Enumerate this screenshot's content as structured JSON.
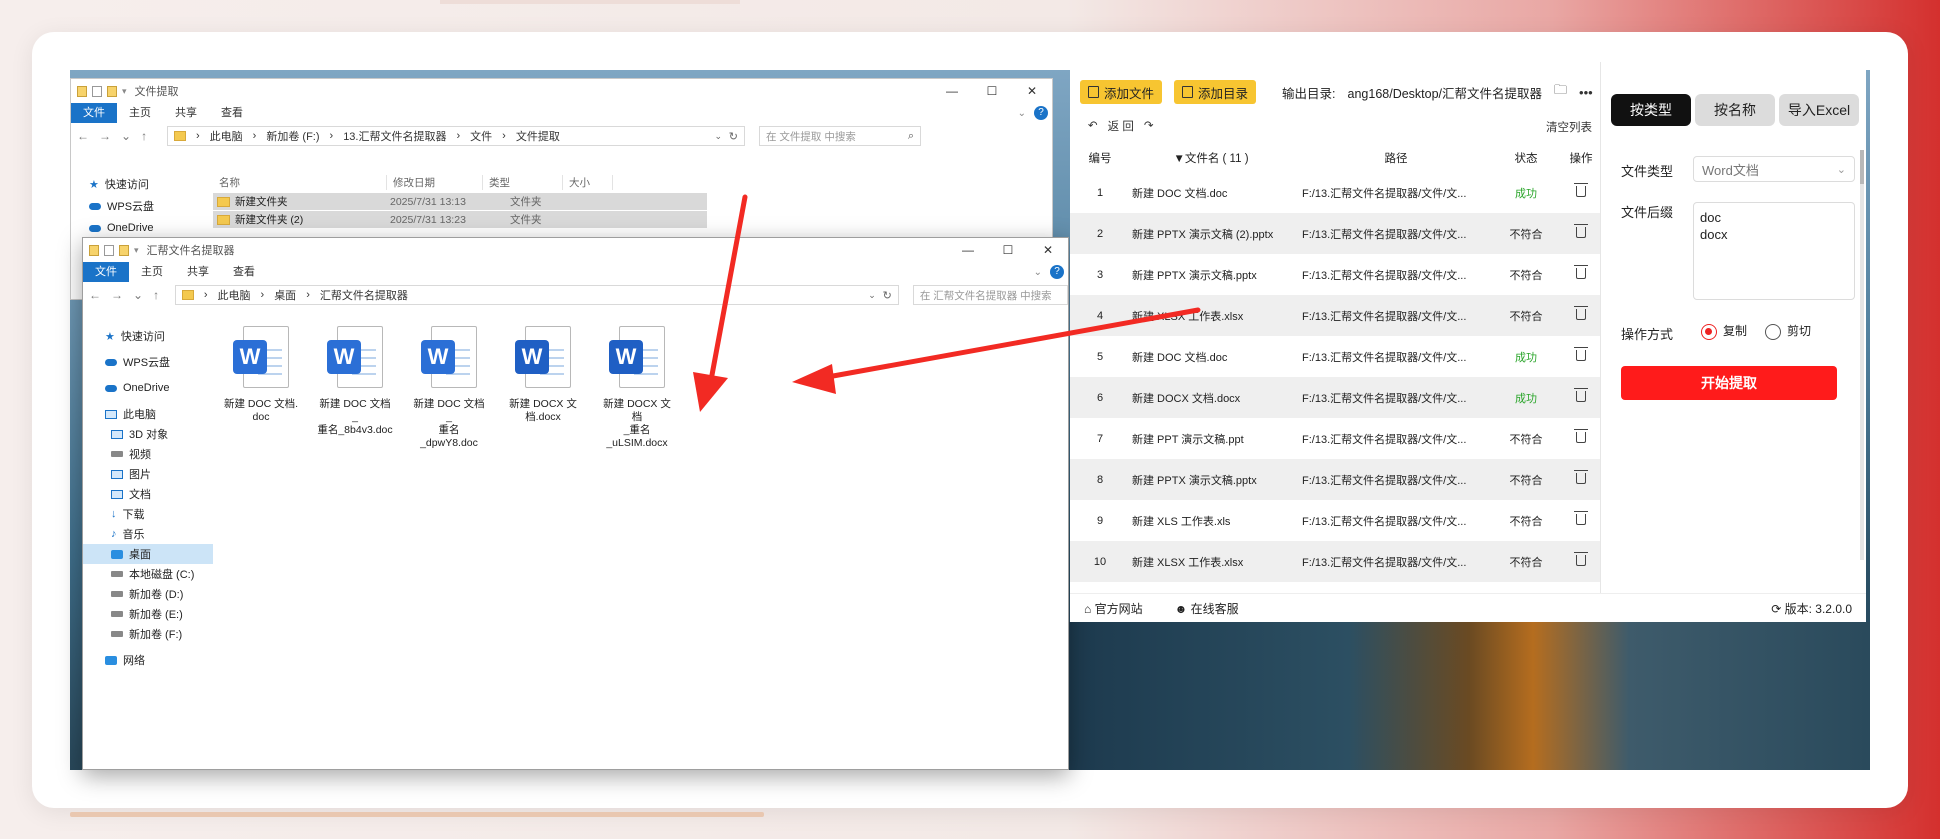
{
  "win1": {
    "title": "文件提取",
    "ribbon": [
      "文件",
      "主页",
      "共享",
      "查看"
    ],
    "address": [
      "此电脑",
      "新加卷 (F:)",
      "13.汇帮文件名提取器",
      "文件",
      "文件提取"
    ],
    "search_placeholder": "在 文件提取 中搜索",
    "nav": [
      "快速访问",
      "WPS云盘",
      "OneDrive"
    ],
    "columns": [
      "名称",
      "修改日期",
      "类型",
      "大小"
    ],
    "rows": [
      {
        "name": "新建文件夹",
        "date": "2025/7/31 13:13",
        "type": "文件夹"
      },
      {
        "name": "新建文件夹 (2)",
        "date": "2025/7/31 13:23",
        "type": "文件夹"
      }
    ]
  },
  "win2": {
    "title": "汇帮文件名提取器",
    "ribbon": [
      "文件",
      "主页",
      "共享",
      "查看"
    ],
    "address": [
      "此电脑",
      "桌面",
      "汇帮文件名提取器"
    ],
    "search_placeholder": "在 汇帮文件名提取器 中搜索",
    "nav": [
      "快速访问",
      "WPS云盘",
      "OneDrive",
      "此电脑",
      "3D 对象",
      "视频",
      "图片",
      "文档",
      "下载",
      "音乐",
      "桌面",
      "本地磁盘 (C:)",
      "新加卷 (D:)",
      "新加卷 (E:)",
      "新加卷 (F:)",
      "网络"
    ],
    "files": [
      {
        "line1": "新建 DOC 文档.",
        "line2": "doc",
        "line3": ""
      },
      {
        "line1": "新建 DOC 文档_",
        "line2": "重名_8b4v3.doc",
        "line3": ""
      },
      {
        "line1": "新建 DOC 文档_",
        "line2": "重名",
        "line3": "_dpwY8.doc"
      },
      {
        "line1": "新建 DOCX 文",
        "line2": "档.docx",
        "line3": ""
      },
      {
        "line1": "新建 DOCX 文档",
        "line2": "_重名",
        "line3": "_uLSIM.docx"
      }
    ],
    "icon_letter": "W"
  },
  "app": {
    "add_file": "添加文件",
    "add_dir": "添加目录",
    "output_label": "输出目录:",
    "output_value": "ang168/Desktop/汇帮文件名提取器",
    "back": "返 回",
    "clear_list": "清空列表",
    "headers": {
      "no": "编号",
      "name": "▼文件名 ( 11 )",
      "path": "路径",
      "status": "状态",
      "op": "操作"
    },
    "rows": [
      {
        "no": "1",
        "name": "新建 DOC 文档.doc",
        "path": "F:/13.汇帮文件名提取器/文件/文...",
        "status": "成功"
      },
      {
        "no": "2",
        "name": "新建 PPTX 演示文稿 (2).pptx",
        "path": "F:/13.汇帮文件名提取器/文件/文...",
        "status": "不符合"
      },
      {
        "no": "3",
        "name": "新建 PPTX 演示文稿.pptx",
        "path": "F:/13.汇帮文件名提取器/文件/文...",
        "status": "不符合"
      },
      {
        "no": "4",
        "name": "新建 XLSX 工作表.xlsx",
        "path": "F:/13.汇帮文件名提取器/文件/文...",
        "status": "不符合"
      },
      {
        "no": "5",
        "name": "新建 DOC 文档.doc",
        "path": "F:/13.汇帮文件名提取器/文件/文...",
        "status": "成功"
      },
      {
        "no": "6",
        "name": "新建 DOCX 文档.docx",
        "path": "F:/13.汇帮文件名提取器/文件/文...",
        "status": "成功"
      },
      {
        "no": "7",
        "name": "新建 PPT 演示文稿.ppt",
        "path": "F:/13.汇帮文件名提取器/文件/文...",
        "status": "不符合"
      },
      {
        "no": "8",
        "name": "新建 PPTX 演示文稿.pptx",
        "path": "F:/13.汇帮文件名提取器/文件/文...",
        "status": "不符合"
      },
      {
        "no": "9",
        "name": "新建 XLS 工作表.xls",
        "path": "F:/13.汇帮文件名提取器/文件/文...",
        "status": "不符合"
      },
      {
        "no": "10",
        "name": "新建 XLSX 工作表.xlsx",
        "path": "F:/13.汇帮文件名提取器/文件/文...",
        "status": "不符合"
      }
    ],
    "tabs": [
      "按类型",
      "按名称",
      "导入Excel"
    ],
    "file_type_label": "文件类型",
    "file_type_value": "Word文档",
    "suffix_label": "文件后缀",
    "suffix_value": "doc\ndocx",
    "op_label": "操作方式",
    "op_copy": "复制",
    "op_cut": "剪切",
    "start": "开始提取",
    "footer_site": "官方网站",
    "footer_service": "在线客服",
    "version_label": "版本:",
    "version": "3.2.0.0"
  },
  "colors": {
    "accent_red": "#ff1b1b",
    "yellow": "#f7c531",
    "success": "#2aa52a",
    "explorer_blue": "#1a73c8"
  }
}
